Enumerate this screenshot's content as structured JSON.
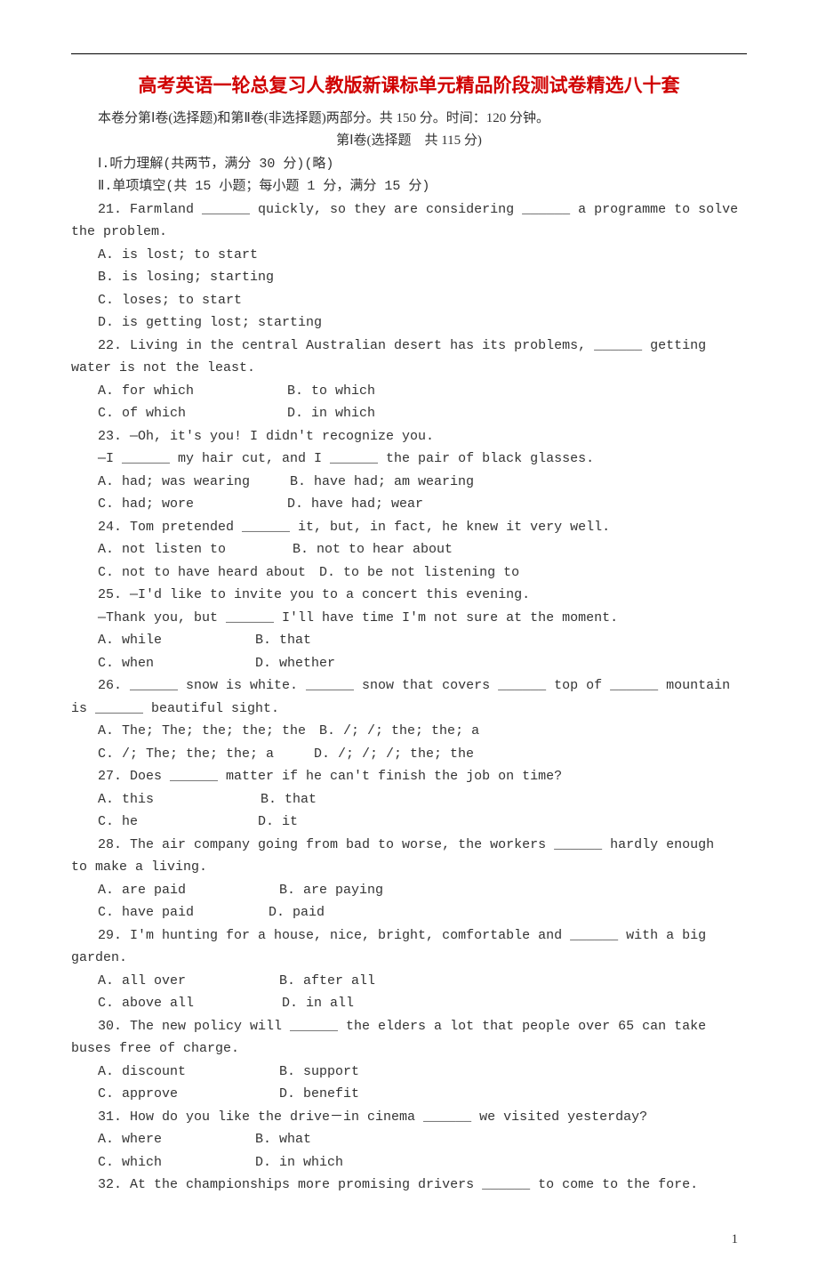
{
  "title": "高考英语一轮总复习人教版新课标单元精品阶段测试卷精选八十套",
  "intro": "本卷分第Ⅰ卷(选择题)和第Ⅱ卷(非选择题)两部分。共 150 分。时间：120 分钟。",
  "part_header": "第Ⅰ卷(选择题　共 115 分)",
  "section1": "Ⅰ.听力理解(共两节，满分 30 分)(略)",
  "section2": "Ⅱ.单项填空(共 15 小题；每小题 1 分，满分 15 分)",
  "q21": {
    "stem1": "21. Farmland ______ quickly, so they are considering ______ a programme to solve",
    "stem2": "the problem.",
    "a": "A. is lost; to start",
    "b": "B. is losing; starting",
    "c": "C. loses; to start",
    "d": "D. is getting lost; starting"
  },
  "q22": {
    "stem1": "22. Living in the central Australian desert has its problems, ______ getting",
    "stem2": "water is not the least.",
    "row1": "A. for which　　　　　　　B. to which",
    "row2": "C. of which　　　　　　　 D. in which"
  },
  "q23": {
    "stem1": "23. —Oh, it's you! I didn't recognize you.",
    "stem2": "—I ______ my hair cut, and I ______ the pair of black glasses.",
    "row1": "A. had; was wearing　　　B. have had; am wearing",
    "row2": "C. had; wore　　　　　　　D. have had; wear"
  },
  "q24": {
    "stem": "24. Tom pretended ______ it, but, in fact, he knew it very well.",
    "row1": "A. not listen to　　　　　B. not to hear about",
    "row2": "C. not to have heard about　D. to be not listening to"
  },
  "q25": {
    "stem1": "25. —I'd like to invite you to a concert this evening.",
    "stem2": "—Thank you, but ______ I'll have time I'm not sure at the moment.",
    "row1": "A. while　　　　　　　B. that",
    "row2": "C. when　　　　　　　 D. whether"
  },
  "q26": {
    "stem1": "26. ______ snow is white. ______ snow that covers ______ top of ______ mountain",
    "stem2": "is ______ beautiful sight.",
    "row1": "A. The; The; the; the; the　B. /; /; the; the; a",
    "row2": "C. /; The; the; the; a　　　D. /; /; /; the; the"
  },
  "q27": {
    "stem": "27. Does ______ matter if he can't finish the job on time?",
    "row1": "A. this　　　　　　　　B. that",
    "row2": "C. he　　　　　　　　　D. it"
  },
  "q28": {
    "stem1": "28. The air company going from bad to worse, the workers ______ hardly enough",
    "stem2": "to make a living.",
    "row1": "A. are paid　　　　　　　B. are paying",
    "row2": "C. have paid　　　　　 D. paid"
  },
  "q29": {
    "stem1": "29. I'm hunting for a house, nice, bright, comfortable and ______ with a big",
    "stem2": "garden.",
    "row1": "A. all over　　　　　　　B. after all",
    "row2": "C. above all　　　　　　 D. in all"
  },
  "q30": {
    "stem1": "30. The new policy will ______ the elders a lot that people over 65 can take",
    "stem2": "buses free of charge.",
    "row1": "A. discount　　　　　　　B. support",
    "row2": "C. approve　　　　　　　 D. benefit"
  },
  "q31": {
    "stem": "31. How do you like the drive－in cinema ______ we visited yesterday?",
    "row1": "A. where　　　　　　　B. what",
    "row2": "C. which　　　　　　　D. in which"
  },
  "q32": {
    "stem": "32. At the championships more promising drivers ______ to come to the fore."
  },
  "page_number": "1"
}
